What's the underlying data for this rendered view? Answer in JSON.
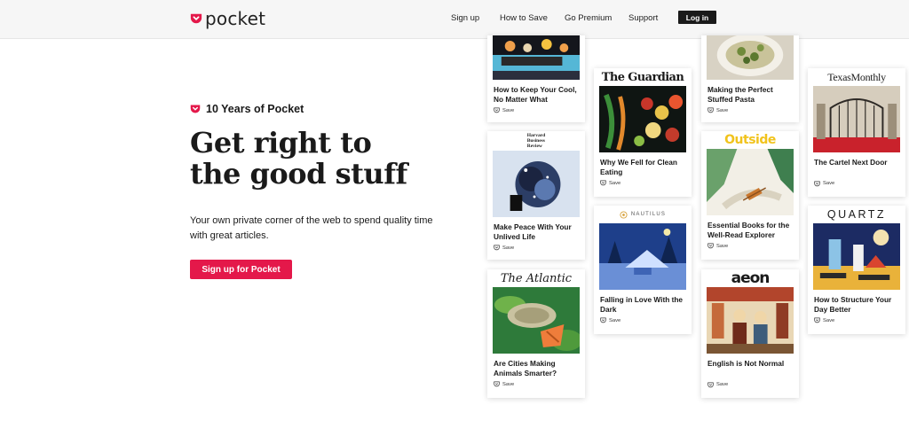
{
  "header": {
    "logo_text": "pocket",
    "nav": {
      "signup": "Sign up",
      "how_to_save": "How to Save",
      "go_premium": "Go Premium",
      "support": "Support"
    },
    "login_label": "Log in"
  },
  "hero": {
    "badge": "10 Years of Pocket",
    "headline_line1": "Get right to",
    "headline_line2": "the good stuff",
    "subtext": "Your own private corner of the web to spend quality time with great articles.",
    "cta_label": "Sign up for Pocket"
  },
  "cards": {
    "cool": {
      "title": "How to Keep Your Cool, No Matter What",
      "save": "Save"
    },
    "peace": {
      "publisher_line1": "Harvard",
      "publisher_line2": "Business",
      "publisher_line3": "Review",
      "title": "Make Peace With Your Unlived Life",
      "save": "Save"
    },
    "cities": {
      "publisher": "The Atlantic",
      "title": "Are Cities Making Animals Smarter?",
      "save": "Save"
    },
    "clean": {
      "publisher": "The Guardian",
      "title": "Why We Fell for Clean Eating",
      "save": "Save"
    },
    "dark": {
      "publisher": "NAUTILUS",
      "title": "Falling in Love With the Dark",
      "save": "Save"
    },
    "pasta": {
      "title": "Making the Perfect Stuffed Pasta",
      "save": "Save"
    },
    "books": {
      "publisher": "Outside",
      "title": "Essential Books for the Well-Read Explorer",
      "save": "Save"
    },
    "english": {
      "publisher": "aeon",
      "title": "English is Not Normal",
      "save": "Save"
    },
    "cartel": {
      "publisher": "TexasMonthly",
      "title": "The Cartel Next Door",
      "save": "Save"
    },
    "bettery": {
      "publisher": "QUARTZ",
      "title": "How to Structure Your Day Better",
      "save": "Save"
    }
  },
  "colors": {
    "brand_red": "#e4184a",
    "login_bg": "#1a1a1a",
    "header_bg": "#f6f6f6"
  },
  "icons": [
    "pocket-logo-icon",
    "pocket-badge-icon",
    "save-icon",
    "nautilus-icon"
  ]
}
